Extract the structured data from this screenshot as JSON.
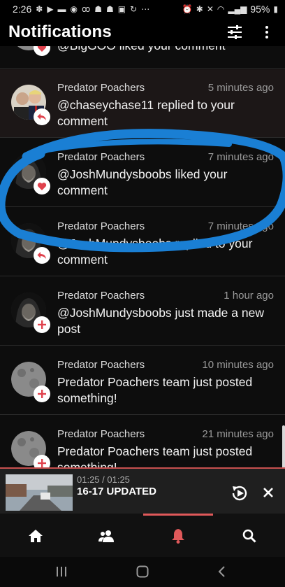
{
  "status_bar": {
    "time": "2:26",
    "battery": "95%"
  },
  "header": {
    "title": "Notifications"
  },
  "notifications": [
    {
      "source": "",
      "time": "",
      "message": "@BigGOO liked your comment",
      "badge": "heart",
      "avatar": "moon"
    },
    {
      "source": "Predator Poachers",
      "time": "5 minutes ago",
      "message": "@chaseychase11 replied to your comment",
      "badge": "reply",
      "avatar": "two-men"
    },
    {
      "source": "Predator Poachers",
      "time": "7 minutes ago",
      "message": "@JoshMundysboobs liked your comment",
      "badge": "heart",
      "avatar": "hooded"
    },
    {
      "source": "Predator Poachers",
      "time": "7 minutes ago",
      "message": "@JoshMundysboobs replied to your comment",
      "badge": "reply",
      "avatar": "hooded"
    },
    {
      "source": "Predator Poachers",
      "time": "1 hour ago",
      "message": "@JoshMundysboobs just made a new post",
      "badge": "plus",
      "avatar": "hooded"
    },
    {
      "source": "Predator Poachers",
      "time": "10 minutes ago",
      "message": "Predator Poachers team just posted something!",
      "badge": "plus",
      "avatar": "moon"
    },
    {
      "source": "Predator Poachers",
      "time": "21 minutes ago",
      "message": "Predator Poachers team just posted something!",
      "badge": "plus",
      "avatar": "moon"
    }
  ],
  "mini_player": {
    "time": "01:25 / 01:25",
    "title": "16-17 UPDATED"
  },
  "bottom_nav": [
    "home-icon",
    "people-icon",
    "bell-icon",
    "search-icon"
  ],
  "colors": {
    "accent": "#e0595a",
    "badge_icon": "#e0424d",
    "highlight": "#1a7fd4"
  }
}
